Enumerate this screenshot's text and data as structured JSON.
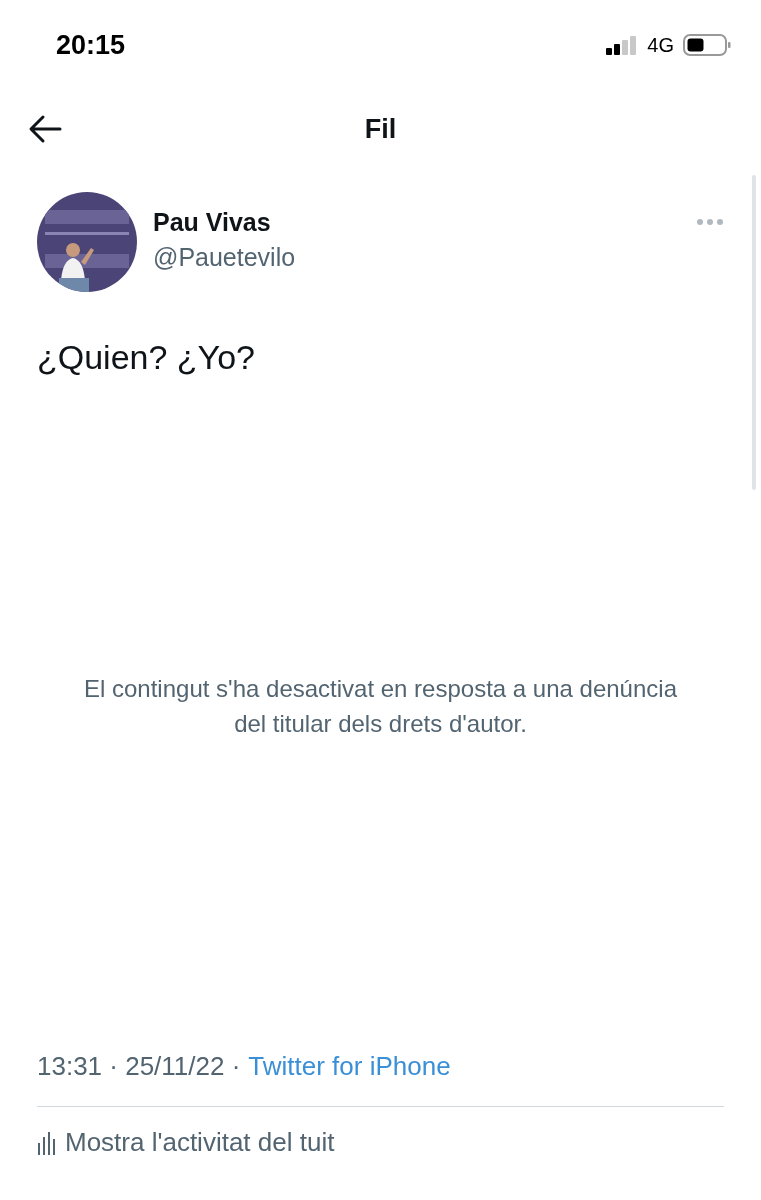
{
  "status_bar": {
    "time": "20:15",
    "network": "4G"
  },
  "header": {
    "title": "Fil"
  },
  "tweet": {
    "author": {
      "name": "Pau Vivas",
      "handle": "@Pauetevilo"
    },
    "text": "¿Quien? ¿Yo?",
    "media_notice": "El contingut s'ha desactivat en resposta a una denúncia del titular dels drets d'autor.",
    "timestamp": "13:31 · 25/11/22 ·",
    "source": "Twitter for iPhone",
    "activity_link": "Mostra l'activitat del tuit"
  }
}
